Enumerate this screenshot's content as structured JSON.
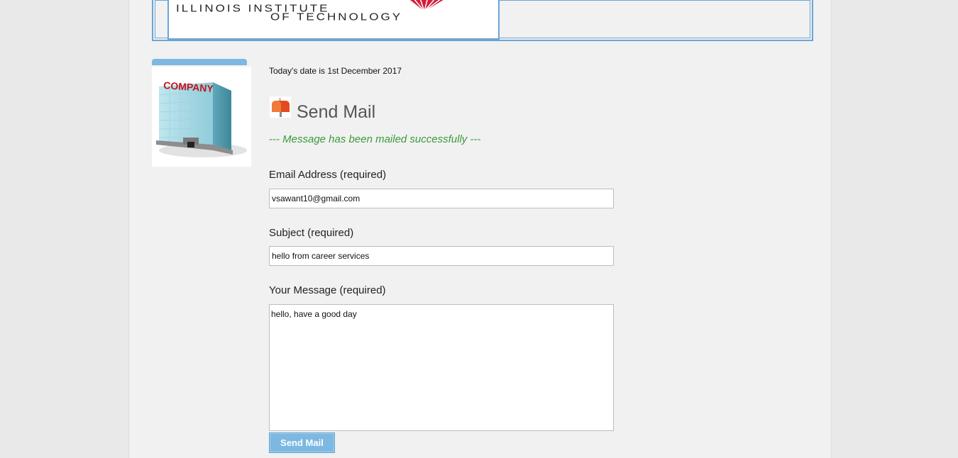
{
  "header": {
    "logo_line1": "ILLINOIS INSTITUTE",
    "logo_line2": "OF TECHNOLOGY"
  },
  "sidebar": {
    "company_image_label": "COMPANY"
  },
  "main": {
    "date_text": "Today's date is 1st December 2017",
    "title": "Send Mail",
    "success_message": "--- Message has been mailed successfully ---"
  },
  "form": {
    "email_label": "Email Address (required)",
    "email_value": "vsawant10@gmail.com",
    "subject_label": "Subject (required)",
    "subject_value": "hello from career services",
    "message_label": "Your Message (required)",
    "message_value": "hello, have a good day",
    "send_label": "Send Mail"
  },
  "colors": {
    "accent": "#7cb8e2",
    "success": "#3a9a3a",
    "logo_red": "#d21f3c"
  }
}
